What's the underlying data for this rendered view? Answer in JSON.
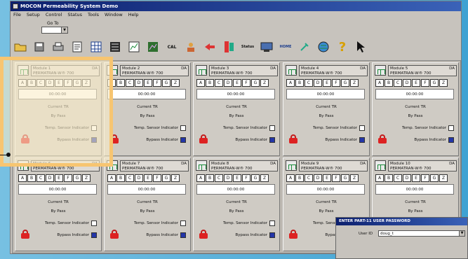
{
  "window": {
    "title": "MOCON Permeability System Demo"
  },
  "menu": [
    "File",
    "Setup",
    "Control",
    "Status",
    "Tools",
    "Window",
    "Help"
  ],
  "goto": {
    "label": "Go To",
    "value": ""
  },
  "toolbar": {
    "icons": [
      "open-folder-icon",
      "save-icon",
      "print-icon",
      "report-icon",
      "grid-icon",
      "table-icon",
      "chart-icon",
      "graph-icon",
      "calibration-icon",
      "users-icon",
      "back-arrow-icon",
      "test-icon",
      "status-icon",
      "network-icon",
      "home-icon",
      "tools-icon",
      "globe-icon",
      "help-icon",
      "pointer-help-icon"
    ],
    "cal_label": "CAL",
    "status_label": "Status",
    "home_label": "HOME"
  },
  "module_common": {
    "model": "PERMATRAN-W® 700",
    "letters": [
      "A",
      "B",
      "C",
      "D",
      "E",
      "F",
      "G",
      "Z"
    ],
    "timer": "00:00:00",
    "current": "Current TR",
    "bypass_state": "By Pass",
    "temp_label": "Temp. Sensor Indicator",
    "bypass_label": "Bypass Indicator"
  },
  "modules": [
    {
      "name": "Module 1",
      "tag": "DA"
    },
    {
      "name": "Module 2",
      "tag": "DA"
    },
    {
      "name": "Module 3",
      "tag": "DA"
    },
    {
      "name": "Module 4",
      "tag": "DA"
    },
    {
      "name": "Module 5",
      "tag": "DA"
    },
    {
      "name": "Module 6",
      "tag": "DA"
    },
    {
      "name": "Module 7",
      "tag": "DA"
    },
    {
      "name": "Module 8",
      "tag": "DA"
    },
    {
      "name": "Module 9",
      "tag": "DA"
    },
    {
      "name": "Module 10",
      "tag": "DA"
    }
  ],
  "password_dialog": {
    "title": "ENTER PART-11 USER PASSWORD",
    "user_label": "User ID",
    "user_value": "doug_t"
  },
  "colors": {
    "titlebar": "#0c1f6e",
    "highlight": "#f7c571",
    "lock": "#d22222",
    "indicator_on": "#2436a8"
  }
}
